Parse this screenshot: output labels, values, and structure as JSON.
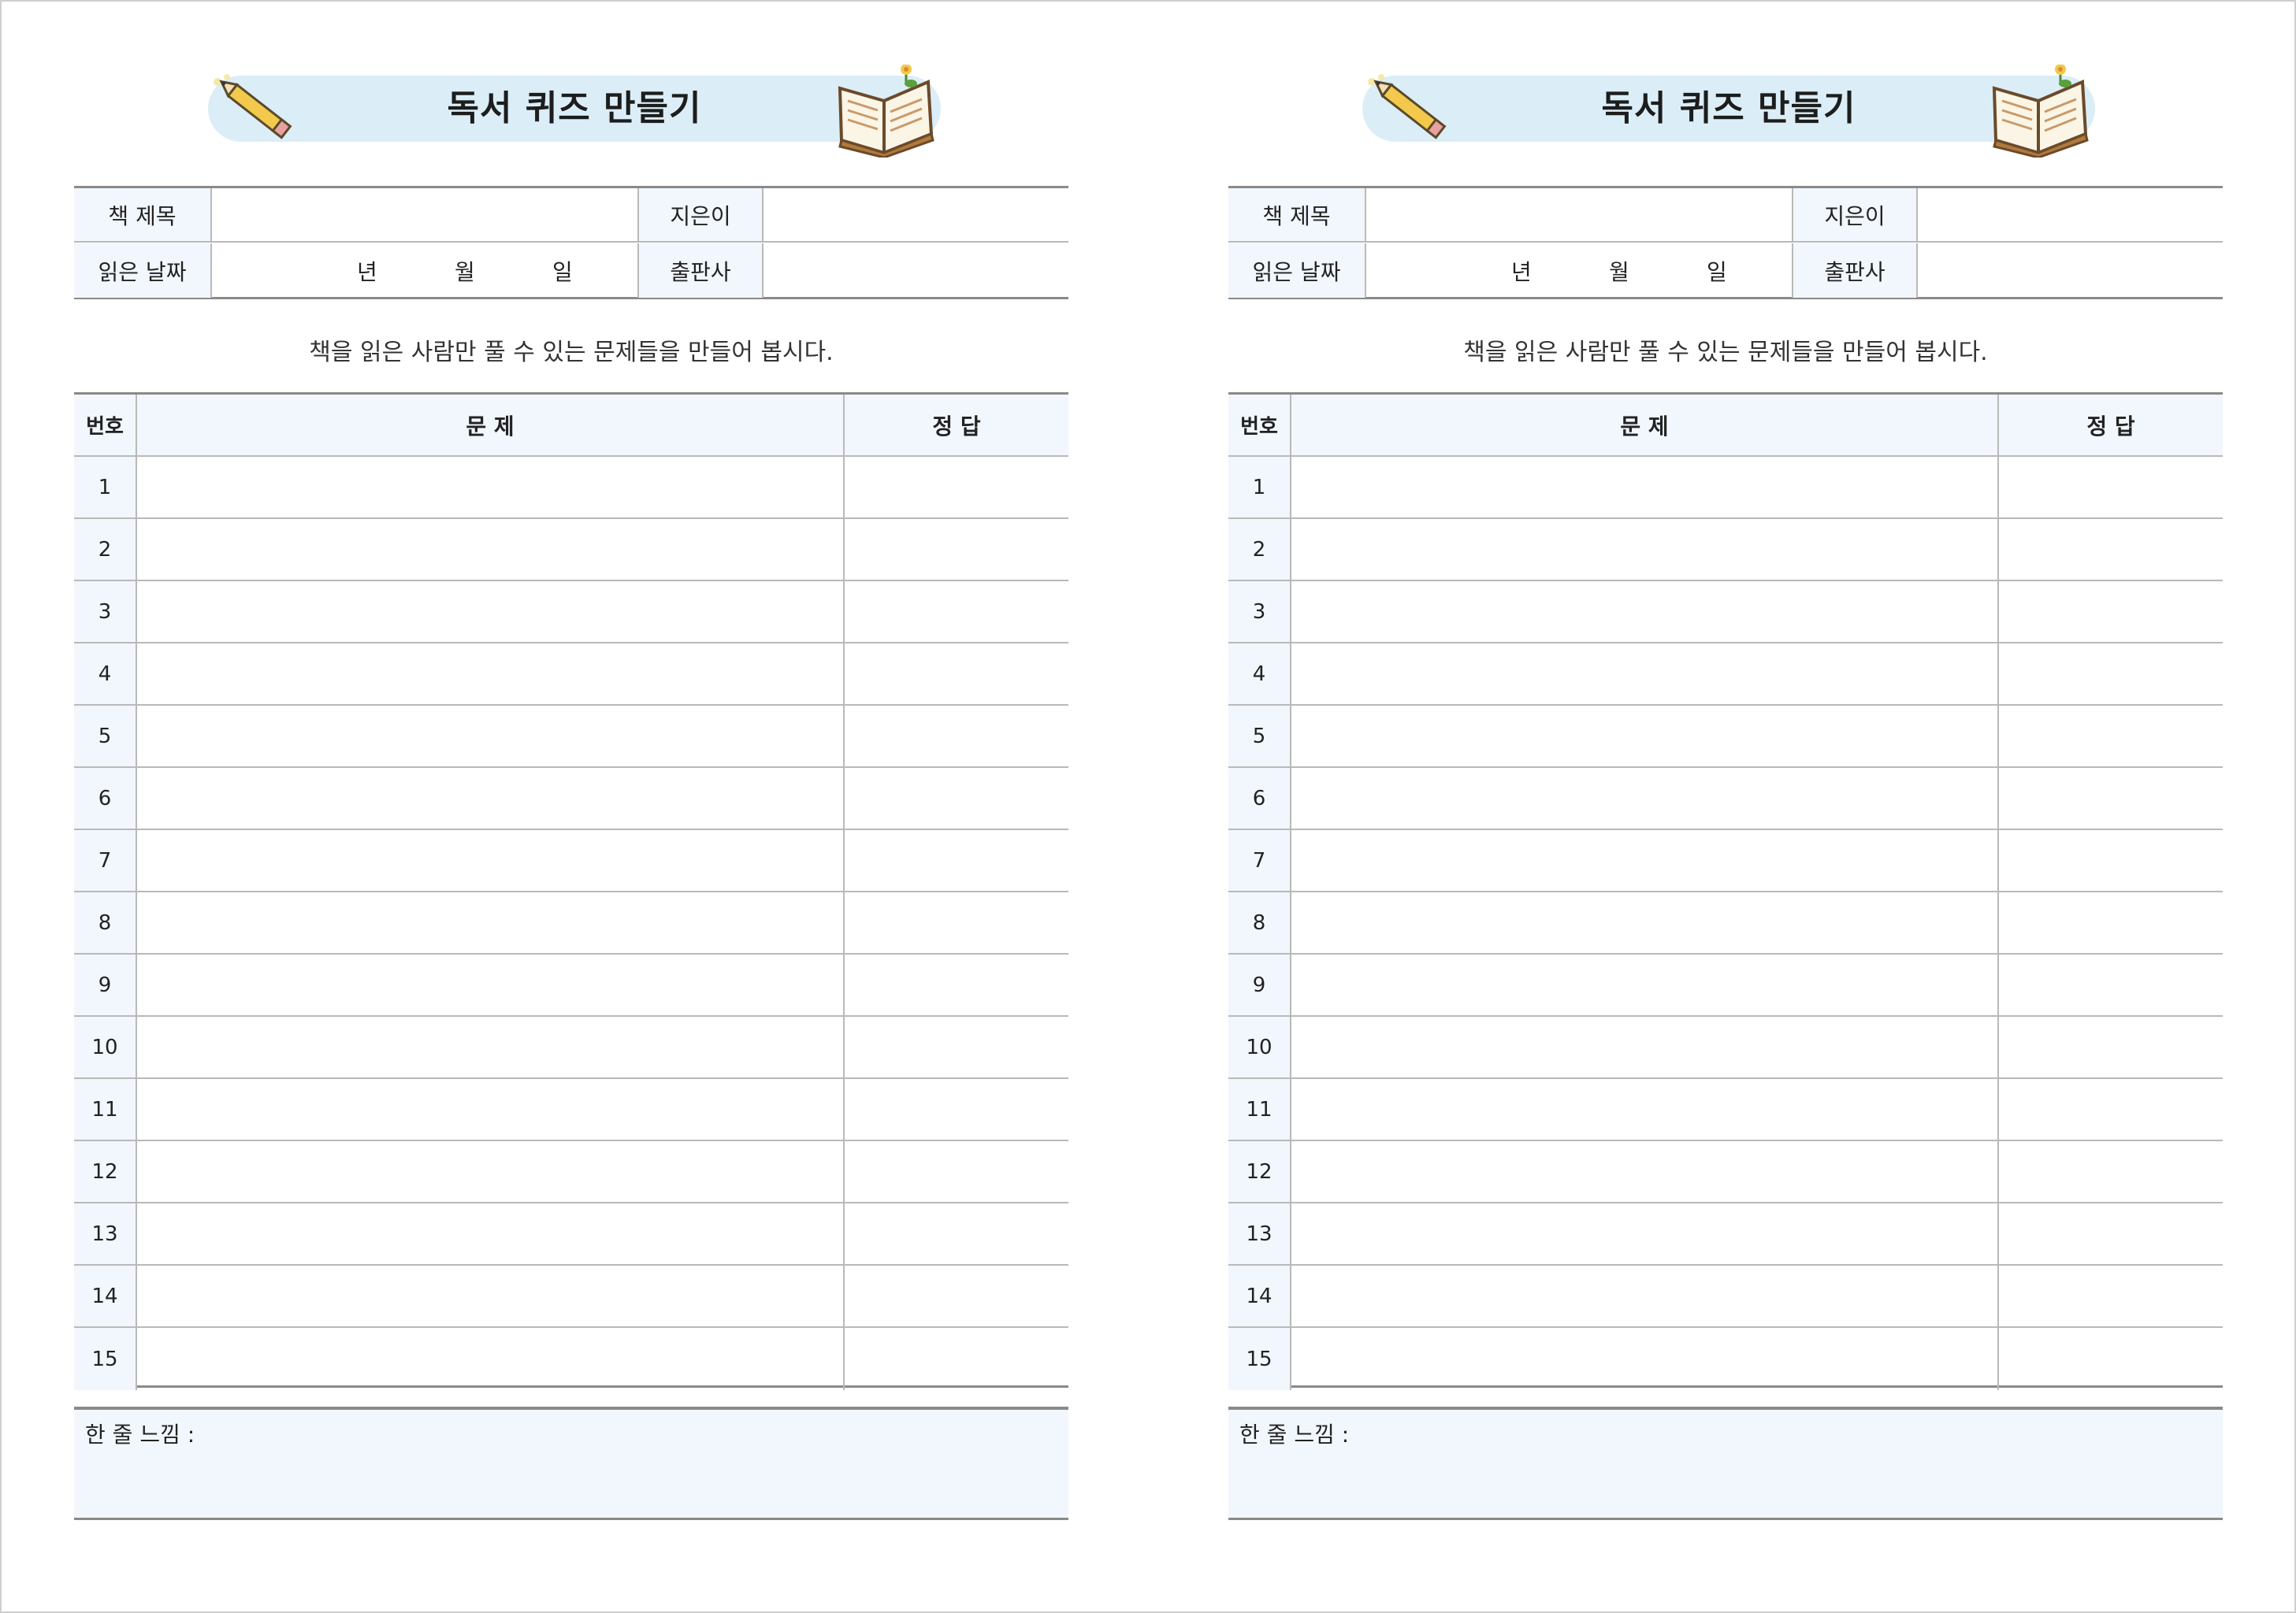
{
  "sheets": [
    {
      "title": "독서 퀴즈 만들기",
      "info": {
        "book_title_label": "책 제목",
        "author_label": "지은이",
        "read_date_label": "읽은 날짜",
        "date_year": "년",
        "date_month": "월",
        "date_day": "일",
        "publisher_label": "출판사"
      },
      "instruction": "책을 읽은 사람만 풀 수 있는 문제들을 만들어 봅시다.",
      "table_headers": {
        "number": "번호",
        "question": "문 제",
        "answer": "정 답"
      },
      "rows": [
        "1",
        "2",
        "3",
        "4",
        "5",
        "6",
        "7",
        "8",
        "9",
        "10",
        "11",
        "12",
        "13",
        "14",
        "15"
      ],
      "feeling_label": "한 줄 느낌 :"
    },
    {
      "title": "독서 퀴즈 만들기",
      "info": {
        "book_title_label": "책 제목",
        "author_label": "지은이",
        "read_date_label": "읽은 날짜",
        "date_year": "년",
        "date_month": "월",
        "date_day": "일",
        "publisher_label": "출판사"
      },
      "instruction": "책을 읽은 사람만 풀 수 있는 문제들을 만들어 봅시다.",
      "table_headers": {
        "number": "번호",
        "question": "문 제",
        "answer": "정 답"
      },
      "rows": [
        "1",
        "2",
        "3",
        "4",
        "5",
        "6",
        "7",
        "8",
        "9",
        "10",
        "11",
        "12",
        "13",
        "14",
        "15"
      ],
      "feeling_label": "한 줄 느낌 :"
    }
  ],
  "icons": [
    "pencil-icon",
    "open-book-icon",
    "flower-icon"
  ],
  "colors": {
    "banner": "#dbeef7",
    "label_bg": "#f1f7fc",
    "rule": "#8a8a8a",
    "grid": "#b9b9b9"
  }
}
